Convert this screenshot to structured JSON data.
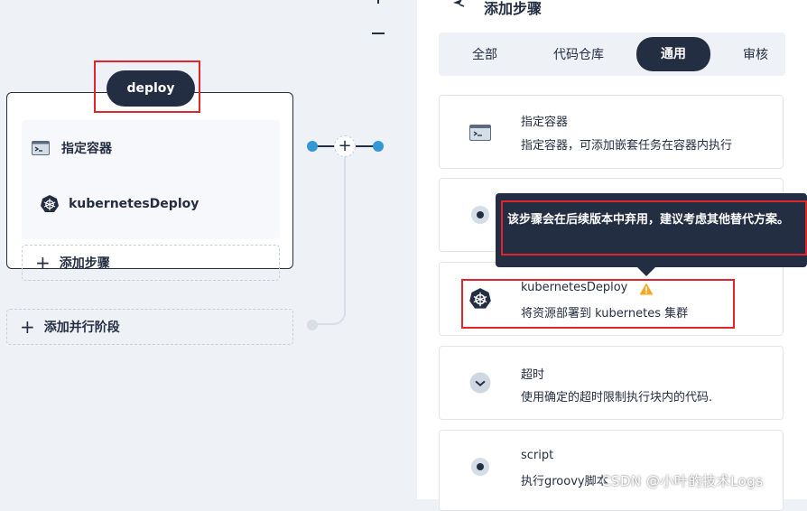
{
  "canvas": {
    "stage_name": "deploy",
    "steps": [
      {
        "label": "指定容器",
        "icon": "terminal-icon"
      },
      {
        "label": "kubernetesDeploy",
        "icon": "kubernetes-icon"
      }
    ],
    "add_step_label": "添加步骤",
    "add_parallel_label": "添加并行阶段"
  },
  "panel": {
    "title": "添加步骤",
    "tabs": [
      {
        "label": "全部",
        "active": false
      },
      {
        "label": "代码仓库",
        "active": false
      },
      {
        "label": "通用",
        "active": true
      },
      {
        "label": "审核",
        "active": false
      }
    ],
    "cards": [
      {
        "title": "指定容器",
        "desc": "指定容器，可添加嵌套任务在容器内执行",
        "icon": "terminal-icon"
      },
      {
        "title": "",
        "desc": "",
        "icon": "radio-icon"
      },
      {
        "title": "kubernetesDeploy",
        "desc": "将资源部署到 kubernetes 集群",
        "icon": "kubernetes-icon",
        "warning": true
      },
      {
        "title": "超时",
        "desc": "使用确定的超时限制执行块内的代码.",
        "icon": "timeout-icon"
      },
      {
        "title": "script",
        "desc": "执行groovy脚本",
        "icon": "radio-icon"
      }
    ],
    "tooltip": "该步骤会在后续版本中弃用，建议考虑其他替代方案。"
  },
  "watermark": "CSDN @小叶的技术Logs",
  "colors": {
    "primary": "#242e42",
    "accent": "#3399d6",
    "highlight": "#e0262c",
    "warning": "#f5a623"
  }
}
